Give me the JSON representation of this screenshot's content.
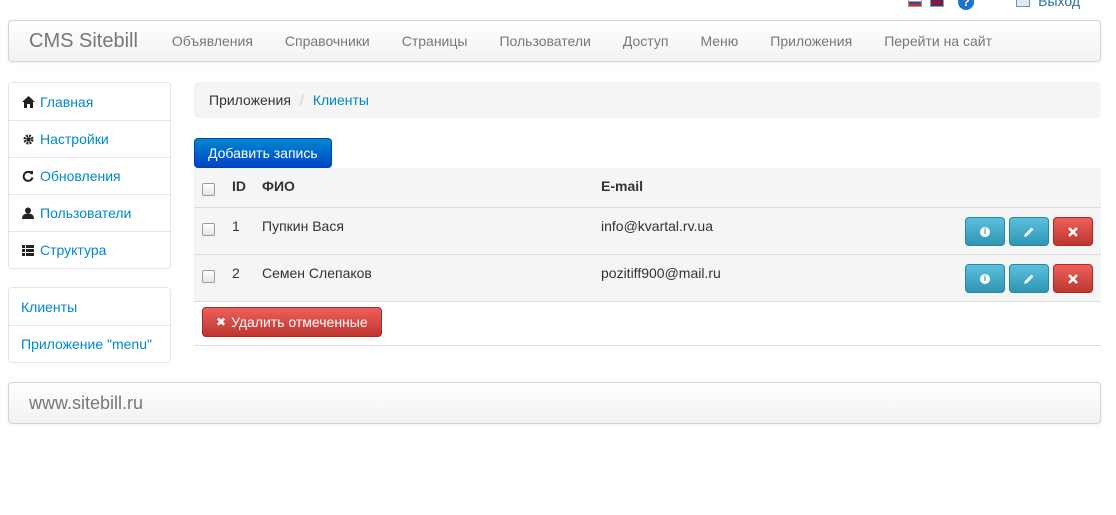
{
  "topbar": {
    "icons": [
      "flag-ru-icon",
      "flag-gb-icon",
      "help-icon",
      "logout-icon"
    ],
    "logout_label": "Выход",
    "help_glyph": "?"
  },
  "navbar": {
    "brand": "CMS Sitebill",
    "items": [
      {
        "label": "Объявления"
      },
      {
        "label": "Справочники"
      },
      {
        "label": "Страницы"
      },
      {
        "label": "Пользователи"
      },
      {
        "label": "Доступ"
      },
      {
        "label": "Меню"
      },
      {
        "label": "Приложения"
      },
      {
        "label": "Перейти на сайт"
      }
    ]
  },
  "sidebar": {
    "items": [
      {
        "label": "Главная",
        "icon": "home-icon"
      },
      {
        "label": "Настройки",
        "icon": "gear-icon"
      },
      {
        "label": "Обновления",
        "icon": "refresh-icon"
      },
      {
        "label": "Пользователи",
        "icon": "user-icon"
      },
      {
        "label": "Структура",
        "icon": "list-icon"
      }
    ],
    "apps": [
      {
        "label": "Клиенты"
      },
      {
        "label": "Приложение \"menu\""
      }
    ]
  },
  "breadcrumb": {
    "parent": "Приложения",
    "separator": "/",
    "current": "Клиенты"
  },
  "main": {
    "add_button": "Добавить запись",
    "delete_selected": "Удалить отмеченные",
    "delete_glyph": "✖",
    "columns": [
      "ID",
      "ФИО",
      "E-mail"
    ],
    "rows": [
      {
        "id": "1",
        "name": "Пупкин Вася",
        "email": "info@kvartal.rv.ua"
      },
      {
        "id": "2",
        "name": "Семен Слепаков",
        "email": "pozitiff900@mail.ru"
      }
    ],
    "row_action_icons": [
      "info-icon",
      "edit-icon",
      "delete-icon"
    ]
  },
  "footer": {
    "text": "www.sitebill.ru"
  },
  "colors": {
    "primary": "#0074cc",
    "info": "#49afcd",
    "danger": "#da4f49",
    "link": "#0088cc"
  }
}
